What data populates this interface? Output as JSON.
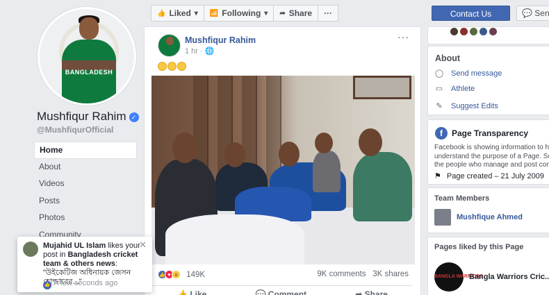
{
  "profile": {
    "name": "Mushfiqur Rahim",
    "handle": "@MushfiqurOfficial",
    "avatar_text": "BANGLADESH"
  },
  "nav": {
    "items": [
      {
        "label": "Home",
        "active": true
      },
      {
        "label": "About"
      },
      {
        "label": "Videos"
      },
      {
        "label": "Posts"
      },
      {
        "label": "Photos"
      },
      {
        "label": "Community"
      }
    ]
  },
  "toolbar": {
    "liked_label": "Liked",
    "following_label": "Following",
    "share_label": "Share",
    "more_label": "···",
    "contact_label": "Contact Us",
    "send_label": "Send"
  },
  "post": {
    "author": "Mushfiqur Rahim",
    "time": "1 hr",
    "reaction_count": "149K",
    "comments": "9K comments",
    "shares": "3K shares",
    "actions": {
      "like": "Like",
      "comment": "Comment",
      "share": "Share"
    }
  },
  "toast": {
    "user": "Mujahid UL Islam",
    "text_mid": " likes your post in ",
    "group": "Bangladesh cricket team & others news",
    "quote": ": \"উইকেটিজ অধিনায়ক জেসন হোল্ডারের...\"",
    "time": "A few seconds ago",
    "close": "✕"
  },
  "about": {
    "title": "About",
    "send_message": "Send message",
    "category": "Athlete",
    "suggest_edits": "Suggest Edits"
  },
  "transparency": {
    "title": "Page Transparency",
    "desc_lines": [
      "Facebook is showing information to help you",
      "understand the purpose of a Page. See acti",
      "the people who manage and post content."
    ],
    "created": "Page created – 21 July 2009"
  },
  "team": {
    "title": "Team Members",
    "member": "Mushfique Ahmed"
  },
  "liked_pages": {
    "title": "Pages liked by this Page",
    "page_name": "Bangla Warriors Cric...",
    "logo_text": "BANGLA WARRIORS"
  },
  "colors": {
    "brand": "#4267b2",
    "link": "#365899",
    "background": "#e9ebee"
  }
}
